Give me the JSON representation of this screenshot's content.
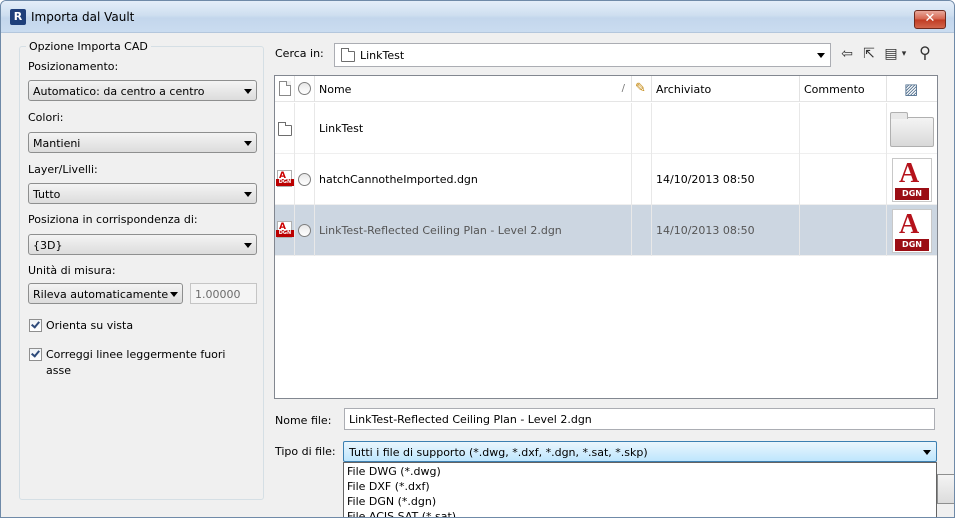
{
  "window": {
    "title": "Importa dal Vault",
    "close_glyph": "✕"
  },
  "left_panel": {
    "group_title": "Opzione Importa CAD",
    "positioning": {
      "label": "Posizionamento:",
      "value": "Automatico: da centro a centro"
    },
    "colors": {
      "label": "Colori:",
      "value": "Mantieni"
    },
    "layers": {
      "label": "Layer/Livelli:",
      "value": "Tutto"
    },
    "place_at": {
      "label": "Posiziona in corrispondenza di:",
      "value": "{3D}"
    },
    "units": {
      "label": "Unità di misura:",
      "value": "Rileva automaticamente",
      "scale": "1.00000"
    },
    "orient_to_view": {
      "label": "Orienta su vista",
      "checked": true
    },
    "correct_lines": {
      "label_line1": "Correggi linee leggermente fuori",
      "label_line2": "asse",
      "checked": true
    }
  },
  "look_in": {
    "label": "Cerca in:",
    "value": "LinkTest"
  },
  "toolbar": {
    "back_icon": "arrow-left-icon",
    "up_folder_icon": "folder-up-icon",
    "views_icon": "details-view-icon",
    "find_icon": "binoculars-icon",
    "back_glyph": "⇦",
    "up_glyph": "⇱",
    "views_glyph": "▤",
    "views_dropdown_glyph": "▾",
    "find_glyph": "⚲"
  },
  "file_list": {
    "columns": {
      "name": "Nome",
      "archived": "Archiviato",
      "comment": "Commento",
      "sort_glyph": "/",
      "archived_glyph": "✎",
      "thumbnail_glyph": "▨"
    },
    "rows": [
      {
        "type": "folder",
        "name": "LinkTest",
        "archived": "",
        "comment": "",
        "selected": false
      },
      {
        "type": "dgn",
        "name": "hatchCannotheImported.dgn",
        "archived": "14/10/2013 08:50",
        "comment": "",
        "selected": false
      },
      {
        "type": "dgn",
        "name": "LinkTest-Reflected Ceiling Plan - Level 2.dgn",
        "archived": "14/10/2013 08:50",
        "comment": "",
        "selected": true
      }
    ],
    "icon_labels": {
      "dgn_tag": "DGN",
      "dgn_big_tag": "DGN",
      "dgn_letter": "A"
    }
  },
  "file_name": {
    "label": "Nome file:",
    "value": "LinkTest-Reflected Ceiling Plan - Level 2.dgn"
  },
  "file_type": {
    "label": "Tipo di file:",
    "value": "Tutti i file di supporto (*.dwg, *.dxf, *.dgn, *.sat, *.skp)",
    "options": [
      "File DWG (*.dwg)",
      "File DXF (*.dxf)",
      "File DGN (*.dgn)",
      "File ACIS SAT (*.sat)"
    ]
  }
}
